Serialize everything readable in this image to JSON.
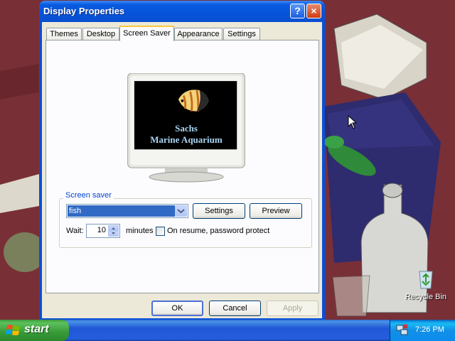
{
  "window": {
    "title": "Display Properties",
    "help_button": "?",
    "close_button": "×"
  },
  "tabs": [
    {
      "label": "Themes",
      "active": false
    },
    {
      "label": "Desktop",
      "active": false
    },
    {
      "label": "Screen Saver",
      "active": true
    },
    {
      "label": "Appearance",
      "active": false
    },
    {
      "label": "Settings",
      "active": false
    }
  ],
  "preview": {
    "line1": "Sachs",
    "line2": "Marine Aquarium"
  },
  "screen_saver": {
    "group_label": "Screen saver",
    "selected": "fish",
    "settings_button": "Settings",
    "preview_button": "Preview",
    "wait_label": "Wait:",
    "wait_value": "10",
    "minutes_label": "minutes",
    "password_label": "On resume, password protect",
    "password_checked": false
  },
  "buttons": {
    "ok": "OK",
    "cancel": "Cancel",
    "apply": "Apply"
  },
  "desktop": {
    "recycle_bin_label": "Recycle Bin"
  },
  "taskbar": {
    "start_label": "start",
    "clock": "7:26 PM"
  },
  "colors": {
    "titlebar": "#0553d8",
    "desktop": "#7a2f35",
    "selection": "#316ac5",
    "group_label": "#0046d5"
  }
}
